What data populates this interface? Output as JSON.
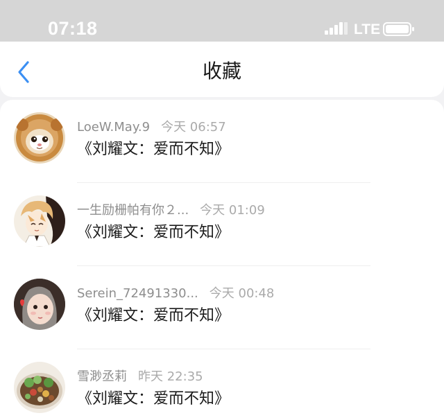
{
  "status_bar": {
    "time": "07:18",
    "network": "LTE",
    "signal_icon": "signal-bars-icon",
    "battery_icon": "battery-icon"
  },
  "header": {
    "title": "收藏",
    "back_icon": "chevron-left-icon"
  },
  "favorites": [
    {
      "username": "LoeW.May.9",
      "time": "今天 06:57",
      "title": "《刘耀文：爱而不知》",
      "avatar": "lion-cat-avatar"
    },
    {
      "username": "一生励栅帕有你２...",
      "time": "今天 01:09",
      "title": "《刘耀文：爱而不知》",
      "avatar": "anime-boy-avatar"
    },
    {
      "username": "Serein_72491330...",
      "time": "今天 00:48",
      "title": "《刘耀文：爱而不知》",
      "avatar": "girl-photo-avatar"
    },
    {
      "username": "雪渺丞莉",
      "time": "昨天 22:35",
      "title": "《刘耀文：爱而不知》",
      "avatar": "food-photo-avatar"
    }
  ],
  "colors": {
    "accent": "#3b8ff3",
    "status_bar_bg": "#d6d6d6",
    "page_bg": "#f2f2f4"
  }
}
